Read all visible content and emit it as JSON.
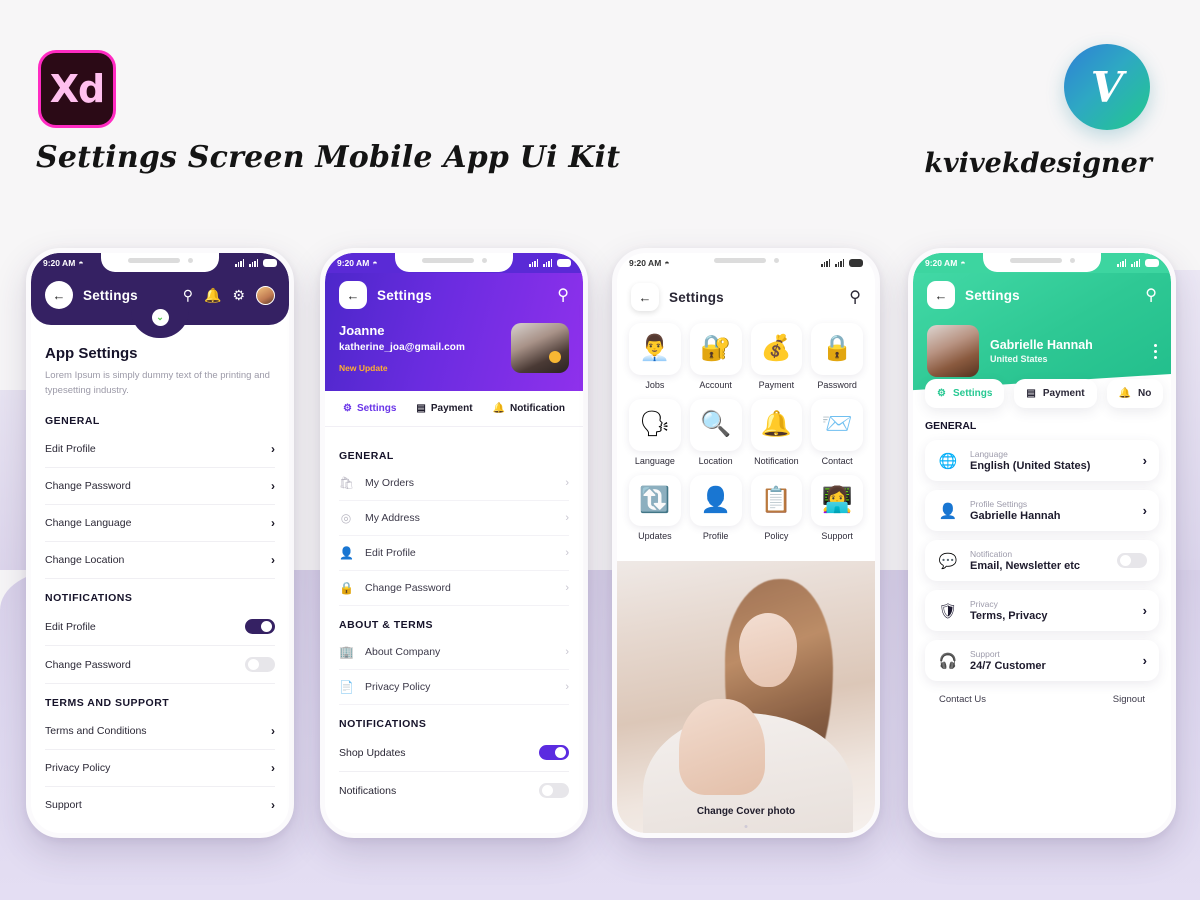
{
  "poster": {
    "logo_text": "Xd",
    "title": "Settings Screen Mobile App Ui Kit",
    "brand_mark": "V",
    "brand_name": "kvivekdesigner",
    "colors": {
      "background": "#f7f6f7",
      "lavender": "#ddd6ec",
      "xd_pink": "#ff2bc2",
      "xd_dark": "#2b0a16"
    }
  },
  "phone1": {
    "accent": "#352163",
    "status": {
      "time": "9:20 AM",
      "wifi": "wifi-icon",
      "signal": "signal-icon",
      "battery": "battery-icon"
    },
    "header": {
      "back": "←",
      "title": "Settings",
      "icons": [
        "search-icon",
        "bell-icon",
        "gear-icon",
        "avatar"
      ]
    },
    "pull_tab": "⌄",
    "page_title": "App Settings",
    "page_sub": "Lorem Ipsum is simply dummy text of the printing and typesetting industry.",
    "sections": [
      {
        "title": "GENERAL",
        "type": "chevron",
        "rows": [
          {
            "label": "Edit Profile"
          },
          {
            "label": "Change Password"
          },
          {
            "label": "Change Language"
          },
          {
            "label": "Change Location"
          }
        ]
      },
      {
        "title": "NOTIFICATIONS",
        "type": "toggle",
        "rows": [
          {
            "label": "Edit Profile",
            "on": true
          },
          {
            "label": "Change Password",
            "on": false
          }
        ]
      },
      {
        "title": "TERMS AND SUPPORT",
        "type": "chevron",
        "rows": [
          {
            "label": "Terms and Conditions"
          },
          {
            "label": "Privacy Policy"
          },
          {
            "label": "Support"
          }
        ]
      }
    ]
  },
  "phone2": {
    "accent_from": "#4b27c9",
    "accent_to": "#8f31ec",
    "status": {
      "time": "9:20 AM"
    },
    "header": {
      "back": "←",
      "title": "Settings",
      "search": "search-icon"
    },
    "profile": {
      "name": "Joanne",
      "email": "katherine_joa@gmail.com",
      "badge": "New Update"
    },
    "tabs": [
      {
        "label": "Settings",
        "icon": "gear-icon",
        "active": true
      },
      {
        "label": "Payment",
        "icon": "card-icon",
        "active": false
      },
      {
        "label": "Notification",
        "icon": "bell-icon",
        "active": false
      }
    ],
    "sections": [
      {
        "title": "GENERAL",
        "type": "chevron",
        "rows": [
          {
            "label": "My Orders",
            "icon": "bag-icon"
          },
          {
            "label": "My Address",
            "icon": "pin-icon"
          },
          {
            "label": "Edit Profile",
            "icon": "person-icon"
          },
          {
            "label": "Change Password",
            "icon": "lock-icon"
          }
        ]
      },
      {
        "title": "ABOUT & TERMS",
        "type": "chevron",
        "rows": [
          {
            "label": "About Company",
            "icon": "building-icon"
          },
          {
            "label": "Privacy Policy",
            "icon": "document-icon"
          }
        ]
      },
      {
        "title": "NOTIFICATIONS",
        "type": "toggle",
        "rows": [
          {
            "label": "Shop Updates",
            "on": true
          },
          {
            "label": "Notifications",
            "on": false
          }
        ]
      }
    ]
  },
  "phone3": {
    "status": {
      "time": "9:20 AM"
    },
    "header": {
      "back": "←",
      "title": "Settings",
      "search": "search-icon"
    },
    "tiles": [
      {
        "label": "Jobs",
        "icon": "👨‍💼"
      },
      {
        "label": "Account",
        "icon": "🔐"
      },
      {
        "label": "Payment",
        "icon": "💰"
      },
      {
        "label": "Password",
        "icon": "🔒"
      },
      {
        "label": "Language",
        "icon": "🗣"
      },
      {
        "label": "Location",
        "icon": "🔍"
      },
      {
        "label": "Notification",
        "icon": "🔔"
      },
      {
        "label": "Contact",
        "icon": "📨"
      },
      {
        "label": "Updates",
        "icon": "🔃"
      },
      {
        "label": "Profile",
        "icon": "👤"
      },
      {
        "label": "Policy",
        "icon": "📋"
      },
      {
        "label": "Support",
        "icon": "👩‍💻"
      }
    ],
    "cover_label": "Change Cover photo"
  },
  "phone4": {
    "accent_from": "#45dba8",
    "accent_to": "#21bd8b",
    "status": {
      "time": "9:20 AM"
    },
    "header": {
      "back": "←",
      "title": "Settings",
      "search": "search-icon"
    },
    "profile": {
      "name": "Gabrielle Hannah",
      "location": "United States",
      "menu": "kebab-icon"
    },
    "tabs": [
      {
        "label": "Settings",
        "icon": "gear-icon",
        "active": true
      },
      {
        "label": "Payment",
        "icon": "card-icon",
        "active": false
      },
      {
        "label": "No",
        "icon": "bell-icon",
        "active": false
      }
    ],
    "section_title": "GENERAL",
    "cards": [
      {
        "title": "Language",
        "value": "English (United States)",
        "icon": "translate-icon",
        "control": "chevron"
      },
      {
        "title": "Profile Settings",
        "value": "Gabrielle Hannah",
        "icon": "person-icon",
        "control": "chevron"
      },
      {
        "title": "Notification",
        "value": "Email, Newsletter etc",
        "icon": "message-icon",
        "control": "toggle",
        "on": false
      },
      {
        "title": "Privacy",
        "value": "Terms, Privacy",
        "icon": "shield-doc-icon",
        "control": "chevron"
      },
      {
        "title": "Support",
        "value": "24/7 Customer",
        "icon": "headset-icon",
        "control": "chevron"
      }
    ],
    "footer": {
      "left": "Contact Us",
      "right": "Signout"
    }
  }
}
